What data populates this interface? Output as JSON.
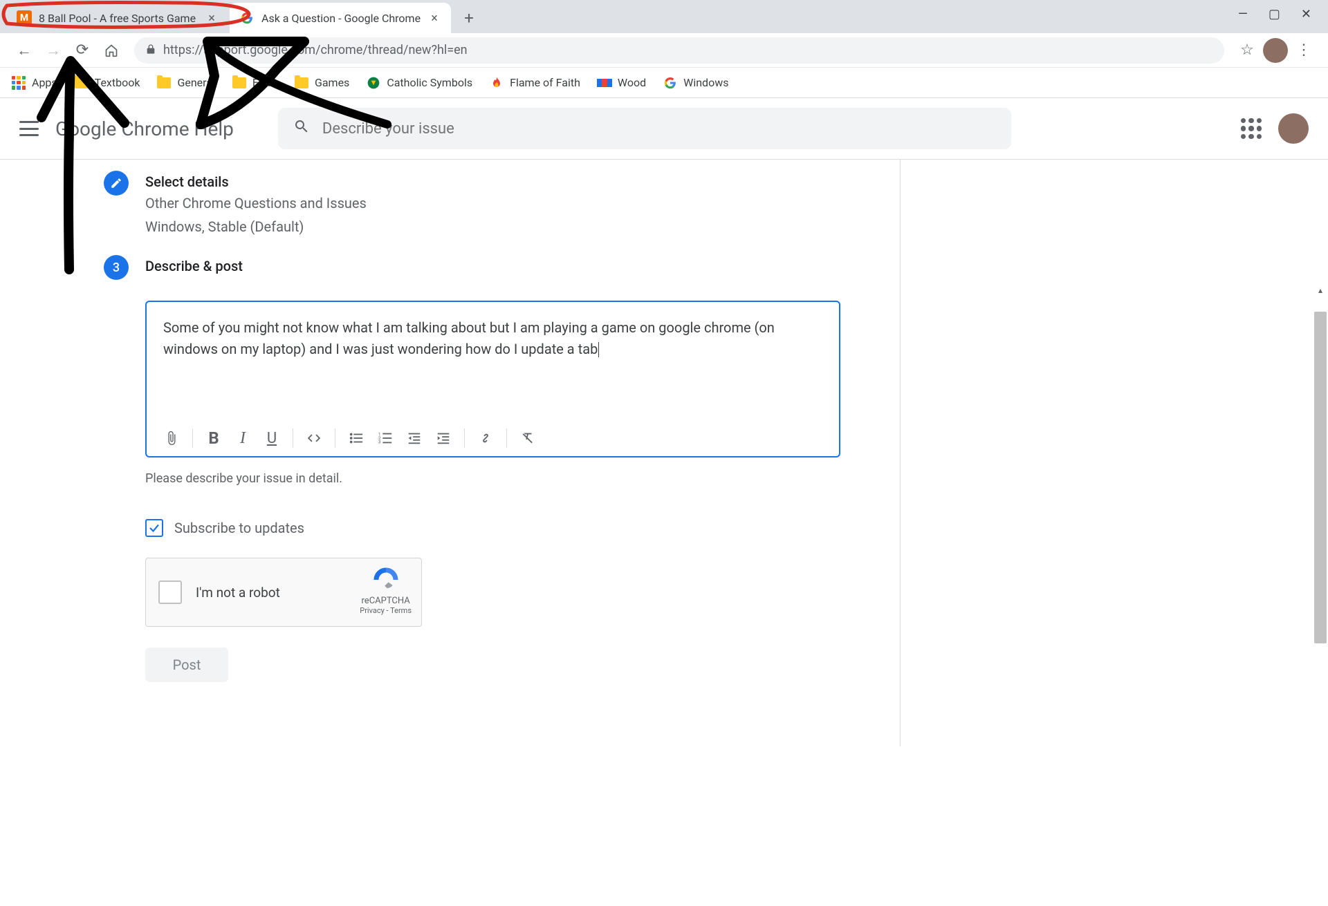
{
  "browser": {
    "tabs": [
      {
        "title": "8 Ball Pool - A free Sports Game",
        "favicon_color": "#ef6c00",
        "favicon_letter": "M",
        "active": false
      },
      {
        "title": "Ask a Question - Google Chrome",
        "favicon_letter": "G",
        "favicon_multicolor": true,
        "active": true
      }
    ],
    "url": "https://support.google.com/chrome/thread/new?hl=en",
    "url_display_prefix": "https://",
    "url_display_host": "support.google.com",
    "url_display_path": "/chrome/thread/new?hl=en"
  },
  "bookmarks": [
    {
      "label": "Apps",
      "icon": "apps-grid"
    },
    {
      "label": "Textbook",
      "icon": "folder"
    },
    {
      "label": "General",
      "icon": "folder"
    },
    {
      "label": "Extra",
      "icon": "folder"
    },
    {
      "label": "Games",
      "icon": "folder"
    },
    {
      "label": "Catholic Symbols",
      "icon": "globe-green"
    },
    {
      "label": "Flame of Faith",
      "icon": "flame"
    },
    {
      "label": "Wood",
      "icon": "wood"
    },
    {
      "label": "Windows",
      "icon": "google-g"
    }
  ],
  "help_header": {
    "title": "Google Chrome Help",
    "search_placeholder": "Describe your issue"
  },
  "form": {
    "step_select": {
      "title": "Select details",
      "line1": "Other Chrome Questions and Issues",
      "line2": "Windows, Stable (Default)"
    },
    "step_describe": {
      "number": "3",
      "title": "Describe & post"
    },
    "editor_text": "Some of you might not know what I am talking about but I am playing a game on google chrome (on windows on my laptop) and I was just wondering how do I update a tab",
    "hint": "Please describe your issue in detail.",
    "subscribe_label": "Subscribe to updates",
    "subscribe_checked": true,
    "recaptcha": {
      "label": "I'm not a robot",
      "brand": "reCAPTCHA",
      "links": "Privacy - Terms"
    },
    "post_label": "Post"
  }
}
